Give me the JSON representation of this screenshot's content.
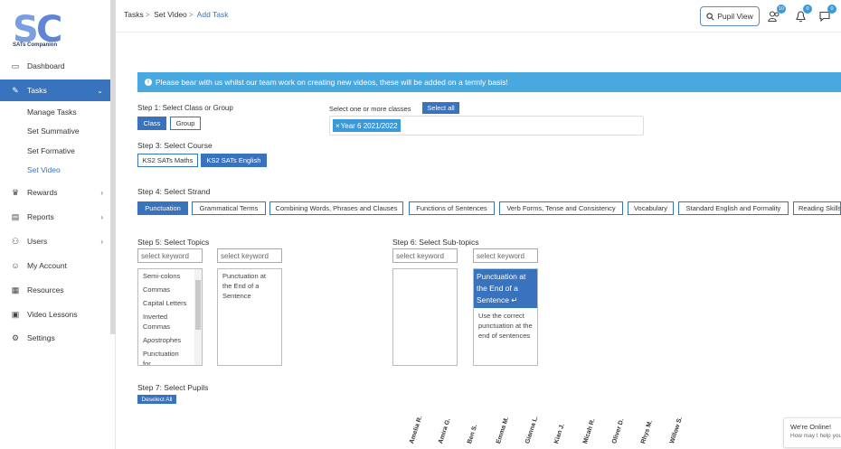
{
  "sidebar": {
    "logo_text": "SATs Companion",
    "items": [
      {
        "label": "Dashboard",
        "icon": "monitor-icon"
      },
      {
        "label": "Tasks",
        "icon": "tasks-icon"
      },
      {
        "label": "Rewards",
        "icon": "trophy-icon"
      },
      {
        "label": "Reports",
        "icon": "reports-icon"
      },
      {
        "label": "Users",
        "icon": "users-icon"
      },
      {
        "label": "My Account",
        "icon": "account-icon"
      },
      {
        "label": "Resources",
        "icon": "resources-icon"
      },
      {
        "label": "Video Lessons",
        "icon": "video-icon"
      },
      {
        "label": "Settings",
        "icon": "gear-icon"
      }
    ],
    "sub_items": [
      "Manage Tasks",
      "Set Summative",
      "Set Formative",
      "Set Video"
    ]
  },
  "header": {
    "breadcrumb": [
      "Tasks",
      "Set Video",
      "Add Task"
    ],
    "pupil_view": "Pupil View",
    "badges": {
      "users": "10",
      "notifications": "0",
      "messages": "0"
    }
  },
  "alert": {
    "text": "Please bear with us whilst our team work on creating new videos, these will be added on a termly basis!"
  },
  "step1": {
    "label": "Step 1: Select Class or Group",
    "class_btn": "Class",
    "group_btn": "Group"
  },
  "classes": {
    "label": "Select one or more classes",
    "select_all": "Select all",
    "chip": "Year 6 2021/2022",
    "chip_remove": "×"
  },
  "step3": {
    "label": "Step 3: Select Course",
    "courses": [
      "KS2 SATs Maths",
      "KS2 SATs English"
    ]
  },
  "step4": {
    "label": "Step 4: Select Strand",
    "strands": [
      "Punctuation",
      "Grammatical Terms",
      "Combining Words, Phrases and Clauses",
      "Functions of Sentences",
      "Verb Forms, Tense and Consistency",
      "Vocabulary",
      "Standard English and Formality",
      "Reading Skills"
    ]
  },
  "step5": {
    "label": "Step 5: Select Topics",
    "placeholder": "select keyword",
    "topics": [
      "Semi-colons",
      "Commas",
      "Capital Letters",
      "Inverted Commas",
      "Apostrophes",
      "Punctuation for"
    ],
    "selected": "Punctuation at the End of a Sentence"
  },
  "step6": {
    "label": "Step 6: Select Sub-topics",
    "placeholder": "select keyword",
    "selected_title": "Punctuation at the End of a Sentence",
    "selected_desc": "Use the correct punctuation at the end of sentences",
    "return_icon": "↵"
  },
  "step7": {
    "label": "Step 7: Select Pupils",
    "deselect": "Deselect All",
    "pupils": [
      "Amelia R.",
      "Amira G.",
      "Ben S.",
      "Emma M.",
      "Gianna L.",
      "Kian J.",
      "Micah R.",
      "Oliver D.",
      "Rhys M.",
      "Willow S."
    ]
  },
  "chat": {
    "title": "We're Online!",
    "subtitle": "How may I help you"
  },
  "colors": {
    "primary": "#3a73bd",
    "alert": "#4aa8e0"
  }
}
